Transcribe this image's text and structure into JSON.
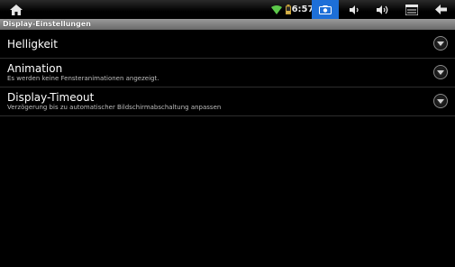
{
  "statusbar": {
    "time": "6:57",
    "icons": [
      "home-icon",
      "wifi-icon",
      "battery-icon",
      "screenshot-icon",
      "volume-down-icon",
      "volume-up-icon",
      "menu-icon",
      "back-icon"
    ],
    "accent": "#1d6fd8"
  },
  "header": {
    "title": "Display-Einstellungen"
  },
  "settings": [
    {
      "title": "Helligkeit",
      "summary": ""
    },
    {
      "title": "Animation",
      "summary": "Es werden keine Fensteranimationen angezeigt."
    },
    {
      "title": "Display-Timeout",
      "summary": "Verzögerung bis zu automatischer Bildschirmabschaltung anpassen"
    }
  ]
}
